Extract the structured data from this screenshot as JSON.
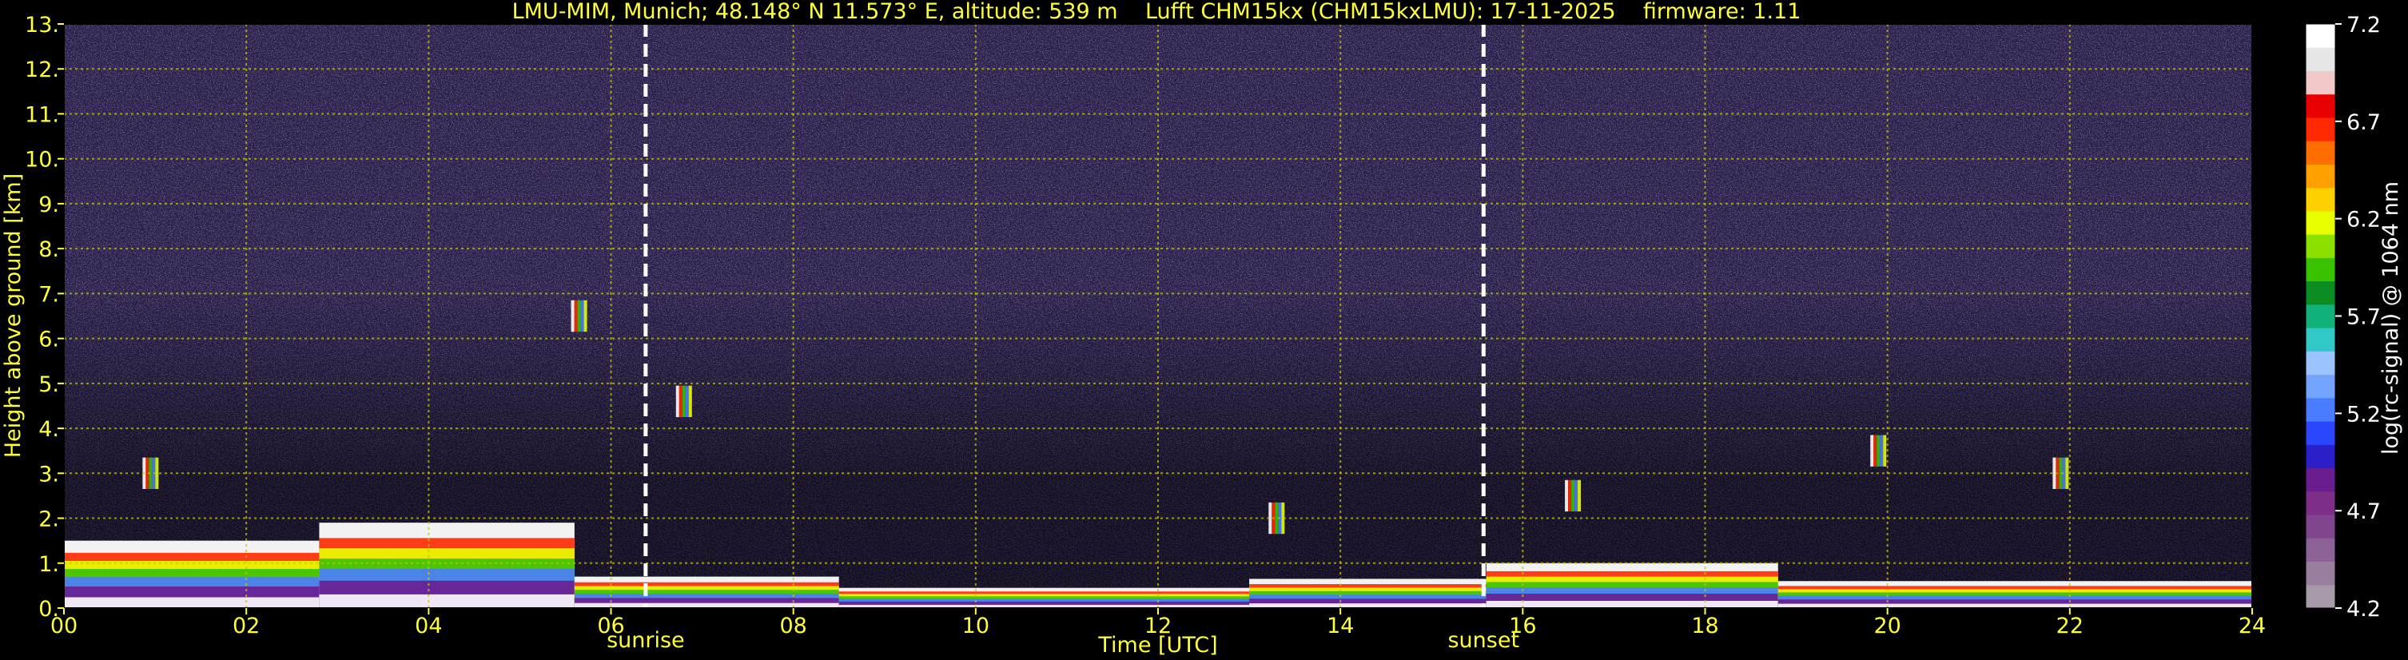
{
  "title": "LMU-MIM, Munich; 48.148° N 11.573° E, altitude: 539 m    Lufft CHM15kx (CHM15kxLMU): 17-11-2025    firmware: 1.11",
  "chart_data": {
    "type": "heatmap",
    "title": "LMU-MIM, Munich; 48.148° N 11.573° E, altitude: 539 m    Lufft CHM15kx (CHM15kxLMU): 17-11-2025    firmware: 1.11",
    "xlabel": "Time [UTC]",
    "ylabel": "Height above ground [km]",
    "xlim": [
      0,
      24
    ],
    "ylim": [
      0,
      13
    ],
    "x_ticks": [
      "00",
      "02",
      "04",
      "06",
      "08",
      "10",
      "12",
      "14",
      "16",
      "18",
      "20",
      "22",
      "24"
    ],
    "y_ticks": [
      "0.",
      "1.",
      "2.",
      "3.",
      "4.",
      "5.",
      "6.",
      "7.",
      "8.",
      "9.",
      "10.",
      "11.",
      "12.",
      "13."
    ],
    "grid": true,
    "markers": [
      {
        "label": "sunrise",
        "x": 6.38
      },
      {
        "label": "sunset",
        "x": 15.57
      }
    ],
    "colorbar": {
      "label": "log(rc-signal) @ 1064 nm",
      "range": [
        4.2,
        7.2
      ],
      "ticks": [
        "4.2",
        "4.7",
        "5.2",
        "5.7",
        "6.2",
        "6.7",
        "7.2"
      ],
      "colors": [
        "#a69aa9",
        "#9a7e9f",
        "#8d6296",
        "#80458c",
        "#7d2f88",
        "#6a1d8f",
        "#2a1fc9",
        "#2a46ff",
        "#4a7cff",
        "#73a2ff",
        "#9bc4ff",
        "#32c8c8",
        "#12b07a",
        "#0b8c22",
        "#3ac200",
        "#8be000",
        "#e8ff00",
        "#ffd000",
        "#ffa000",
        "#ff6e00",
        "#ff2800",
        "#e80000",
        "#f2c9c9",
        "#e6e6e6",
        "#ffffff"
      ]
    },
    "layers": [
      {
        "name": "boundary layer",
        "segments": [
          {
            "x0": 0,
            "x1": 2.8,
            "top": 1.5
          },
          {
            "x0": 2.8,
            "x1": 5.6,
            "top": 1.9
          },
          {
            "x0": 5.6,
            "x1": 8.5,
            "top": 0.7
          },
          {
            "x0": 8.5,
            "x1": 13.0,
            "top": 0.45
          },
          {
            "x0": 13.0,
            "x1": 15.6,
            "top": 0.65
          },
          {
            "x0": 15.6,
            "x1": 18.8,
            "top": 1.0
          },
          {
            "x0": 18.8,
            "x1": 24,
            "top": 0.6
          }
        ]
      },
      {
        "name": "elevated features",
        "points": [
          {
            "x": 5.65,
            "h": 6.5
          },
          {
            "x": 6.8,
            "h": 4.6
          },
          {
            "x": 13.3,
            "h": 2.0
          },
          {
            "x": 19.9,
            "h": 3.5
          },
          {
            "x": 21.9,
            "h": 3.0
          },
          {
            "x": 0.95,
            "h": 3.0
          },
          {
            "x": 16.55,
            "h": 2.5
          }
        ]
      }
    ]
  }
}
